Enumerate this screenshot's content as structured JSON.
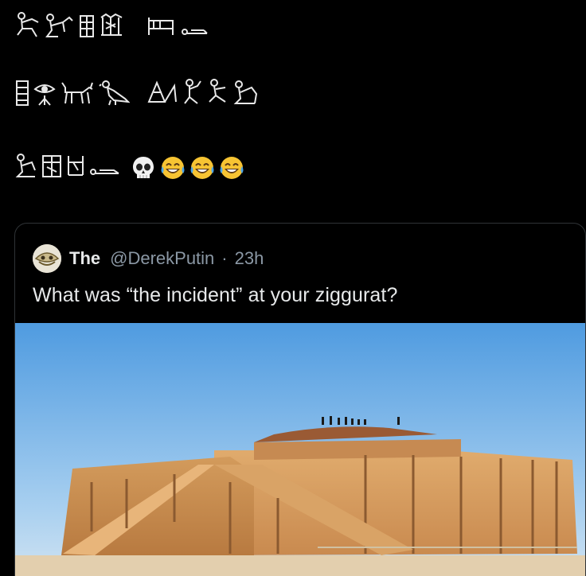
{
  "tweet": {
    "glyph_lines": [
      [
        "kneeling-figure-glyph",
        "seated-figure-glyph",
        "shrine-glyph",
        "plant-glyph",
        "bed-glyph",
        "lying-figure-glyph"
      ],
      [
        "column-glyph",
        "eye-glyph",
        "jackal-glyph",
        "bird-glyph",
        "knife-glyph",
        "seated-figure-glyph",
        "kneeling-figure-glyph",
        "seated-figure-glyph"
      ],
      [
        "seated-figure-glyph",
        "shrine-glyph",
        "plant-glyph",
        "lying-figure-glyph"
      ]
    ],
    "emojis": [
      "skull-emoji",
      "laughing-tears-emoji",
      "laughing-tears-emoji",
      "laughing-tears-emoji"
    ]
  },
  "quote": {
    "author_name": "The",
    "handle": "@DerekPutin",
    "separator": "·",
    "time": "23h",
    "text": "What was “the incident” at your ziggurat?",
    "media_icon": "ziggurat-photo"
  },
  "colors": {
    "background": "#000000",
    "text": "#e7e9ea",
    "secondary": "#8b98a5",
    "border": "#2f3336",
    "sky": "#5ba6e4",
    "brick": "#c98a4f",
    "sand": "#e3cfae"
  }
}
